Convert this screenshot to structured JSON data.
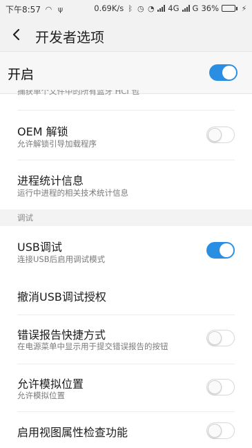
{
  "status_bar": {
    "time": "下午8:57",
    "network_speed": "0.69K/s",
    "signal_1_label": "4G",
    "signal_2_label": "G",
    "battery_percent": "36%",
    "battery_level": 0.36
  },
  "app_bar": {
    "title": "开发者选项",
    "back_icon": "chevron-left-icon"
  },
  "master_switch": {
    "label": "开启",
    "on": true
  },
  "settings": {
    "clipped_row": {
      "subtitle_fragment": "捕获单个文件中的所有蓝牙 HCI 包"
    },
    "oem_unlock": {
      "title": "OEM 解锁",
      "subtitle": "允许解锁引导加载程序",
      "on": false
    },
    "process_stats": {
      "title": "进程统计信息",
      "subtitle": "运行中进程的相关技术统计信息"
    },
    "debug_section": {
      "header": "调试"
    },
    "usb_debug": {
      "title": "USB调试",
      "subtitle": "连接USB后启用调试模式",
      "on": true
    },
    "revoke_usb": {
      "title": "撤消USB调试授权"
    },
    "bug_report": {
      "title": "错误报告快捷方式",
      "subtitle": "在电源菜单中显示用于提交错误报告的按钮",
      "on": false
    },
    "mock_location": {
      "title": "允许模拟位置",
      "subtitle": "允许模拟位置",
      "on": false
    },
    "view_attr": {
      "title": "启用视图属性检查功能",
      "on": false
    }
  },
  "colors": {
    "accent": "#2a8fe3",
    "toggle_off_track": "#ffffff"
  }
}
